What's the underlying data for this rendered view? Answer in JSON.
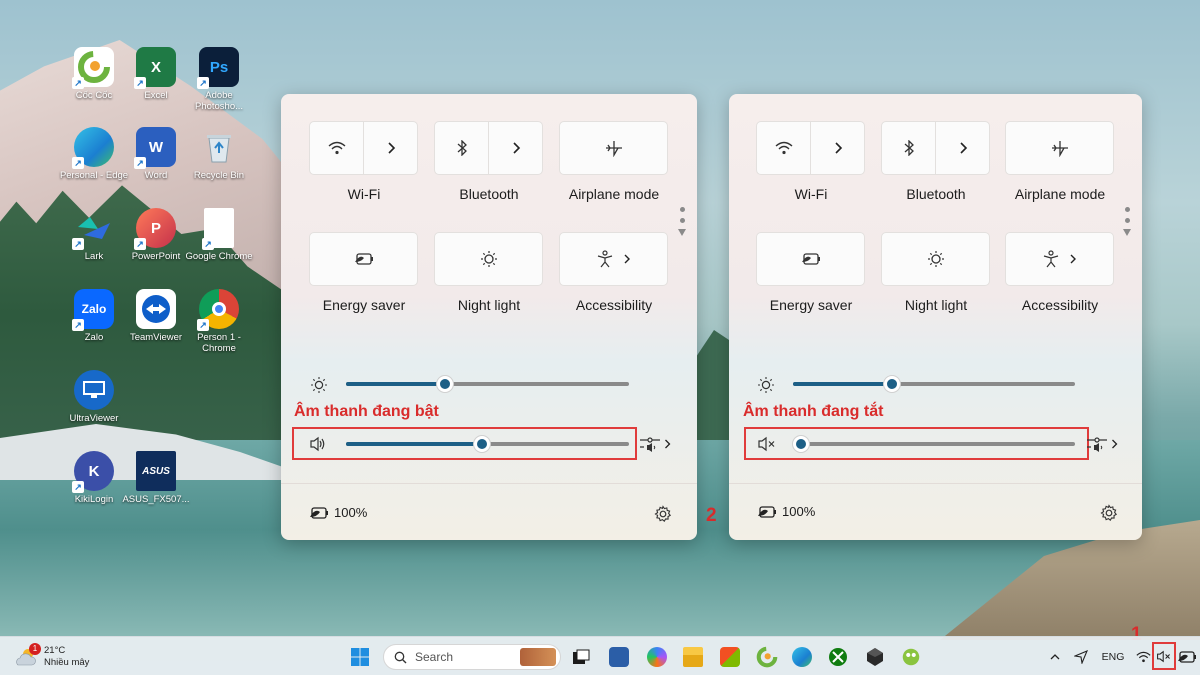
{
  "desktop": {
    "icons": [
      {
        "label": "Cốc Cốc"
      },
      {
        "label": "Excel"
      },
      {
        "label": "Adobe Photosho..."
      },
      {
        "label": "Personal - Edge"
      },
      {
        "label": "Word"
      },
      {
        "label": "Recycle Bin"
      },
      {
        "label": "Lark"
      },
      {
        "label": "PowerPoint"
      },
      {
        "label": "Google Chrome"
      },
      {
        "label": "Zalo"
      },
      {
        "label": "TeamViewer"
      },
      {
        "label": "Person 1 - Chrome"
      },
      {
        "label": "UltraViewer"
      },
      {
        "label": "KikiLogin"
      },
      {
        "label": "ASUS_FX507..."
      }
    ]
  },
  "panel_left": {
    "tiles": {
      "wifi": "Wi-Fi",
      "bluetooth": "Bluetooth",
      "airplane": "Airplane mode",
      "energy": "Energy saver",
      "night": "Night light",
      "accessibility": "Accessibility"
    },
    "brightness_level": 0.35,
    "volume_level": 0.48,
    "annotation": "Âm thanh đang bật",
    "battery": "100%"
  },
  "panel_right": {
    "tiles": {
      "wifi": "Wi-Fi",
      "bluetooth": "Bluetooth",
      "airplane": "Airplane mode",
      "energy": "Energy saver",
      "night": "Night light",
      "accessibility": "Accessibility"
    },
    "brightness_level": 0.35,
    "volume_level": 0.03,
    "annotation": "Âm thanh đang tắt",
    "battery": "100%"
  },
  "step_numbers": {
    "one": "1",
    "two": "2"
  },
  "taskbar": {
    "weather_temp": "21°C",
    "weather_desc": "Nhiều mây",
    "weather_badge": "1",
    "search_placeholder": "Search",
    "language": "ENG"
  },
  "colors": {
    "accent": "#1d5f86",
    "annotation": "#d92c2c"
  }
}
